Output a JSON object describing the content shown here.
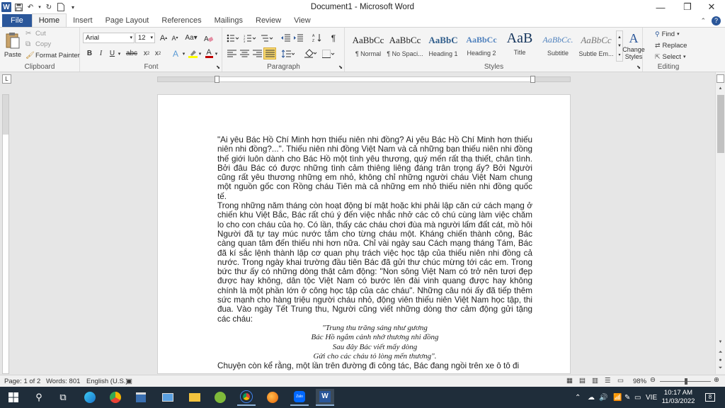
{
  "window": {
    "title": "Document1  -  Microsoft Word",
    "controls": {
      "minimize": "—",
      "restore": "❐",
      "close": "✕"
    }
  },
  "tabs": [
    "File",
    "Home",
    "Insert",
    "Page Layout",
    "References",
    "Mailings",
    "Review",
    "View"
  ],
  "active_tab": "Home",
  "clipboard": {
    "paste": "Paste",
    "cut": "Cut",
    "copy": "Copy",
    "format_painter": "Format Painter",
    "label": "Clipboard"
  },
  "font": {
    "name": "Arial",
    "size": "12",
    "label": "Font"
  },
  "paragraph": {
    "label": "Paragraph"
  },
  "styles": {
    "label": "Styles",
    "items": [
      {
        "preview": "AaBbCc",
        "name": "¶ Normal"
      },
      {
        "preview": "AaBbCc",
        "name": "¶ No Spaci..."
      },
      {
        "preview": "AaBbC",
        "name": "Heading 1"
      },
      {
        "preview": "AaBbCc",
        "name": "Heading 2"
      },
      {
        "preview": "AaB",
        "name": "Title"
      },
      {
        "preview": "AaBbCc.",
        "name": "Subtitle"
      },
      {
        "preview": "AaBbCc",
        "name": "Subtle Em..."
      }
    ],
    "change_styles": "Change Styles"
  },
  "editing": {
    "find": "Find",
    "replace": "Replace",
    "select": "Select",
    "label": "Editing"
  },
  "document": {
    "paragraphs": [
      " \"Ai yêu Bác Hồ Chí Minh hơn thiếu niên nhi đồng? Ai yêu Bác Hồ Chí Minh hơn thiếu niên nhi đồng?...\". Thiếu niên nhi đồng Việt Nam và cả những bạn thiếu niên nhi đồng thế giới luôn dành cho Bác Hồ một tình yêu thương, quý mến rất thạ thiết, chân tình. Bởi đâu Bác có được những tình cảm thiêng liêng đáng trân trọng ấy? Bởi Người cũng rất yêu thương những em nhỏ, không chỉ những người cháu Việt Nam chung một nguồn gốc con Rồng cháu Tiên mà cả những em nhỏ thiếu niên nhi đồng quốc tế.",
      "Trong những năm tháng còn hoạt động bí mật hoặc khi phải lập căn cứ cách mạng ở chiến khu Việt Bắc, Bác rất chú ý đến việc nhắc nhở các cô chú cùng làm việc chăm lo cho con cháu của họ. Có lần, thấy các cháu chơi đùa mà người lấm đất cát, mồ hôi Người đã tự tay múc nước tắm cho từng cháu một. Kháng chiến thành công, Bác càng quan tâm đến thiếu nhi hơn nữa. Chỉ vài ngày sau Cách mạng tháng Tám, Bác đã kí sắc lệnh thành lập cơ quan phụ trách việc học tập của thiếu niên nhi đồng cả nước. Trong ngày khai trường đầu tiên Bác đã gửi thư chúc mừng tới các em. Trong bức thư ấy có những dòng thật cảm động: \"Non sông Việt Nam có trở nên tươi đẹp được hay không, dân tộc Việt Nam có bước lên đài vinh quang được hay không chính là một phần lớn ở công học tập của các cháu\". Những câu nói ấy đã tiếp thêm sức mạnh cho hàng triệu người cháu nhỏ, động viên thiếu niên Việt Nam học tập, thi đua. Vào ngày Tết Trung thu, Người cũng viết những dòng thơ cảm động gửi tặng các cháu:"
    ],
    "poem": [
      "\"Trung thu trăng sáng như gương",
      "Bác Hồ ngắm cảnh nhớ thương nhi đồng",
      "Sau đây Bác viết mấy dòng",
      "Gửi cho các cháu tỏ lòng mến thương\"."
    ],
    "last_line": "Chuyện còn kể rằng, một lần trên đường đi công tác, Bác đang ngồi trên xe ô tô đi"
  },
  "status": {
    "page": "Page: 1 of 2",
    "words": "Words: 801",
    "language": "English (U.S.)",
    "zoom": "98%"
  },
  "taskbar": {
    "language": "VIE",
    "time": "10:17 AM",
    "date": "11/03/2022",
    "notifications": "8"
  },
  "colors": {
    "accent": "#2b579a",
    "taskbar": "#1f2d3a",
    "font_color": "#c00000",
    "highlight": "#ffff00"
  }
}
